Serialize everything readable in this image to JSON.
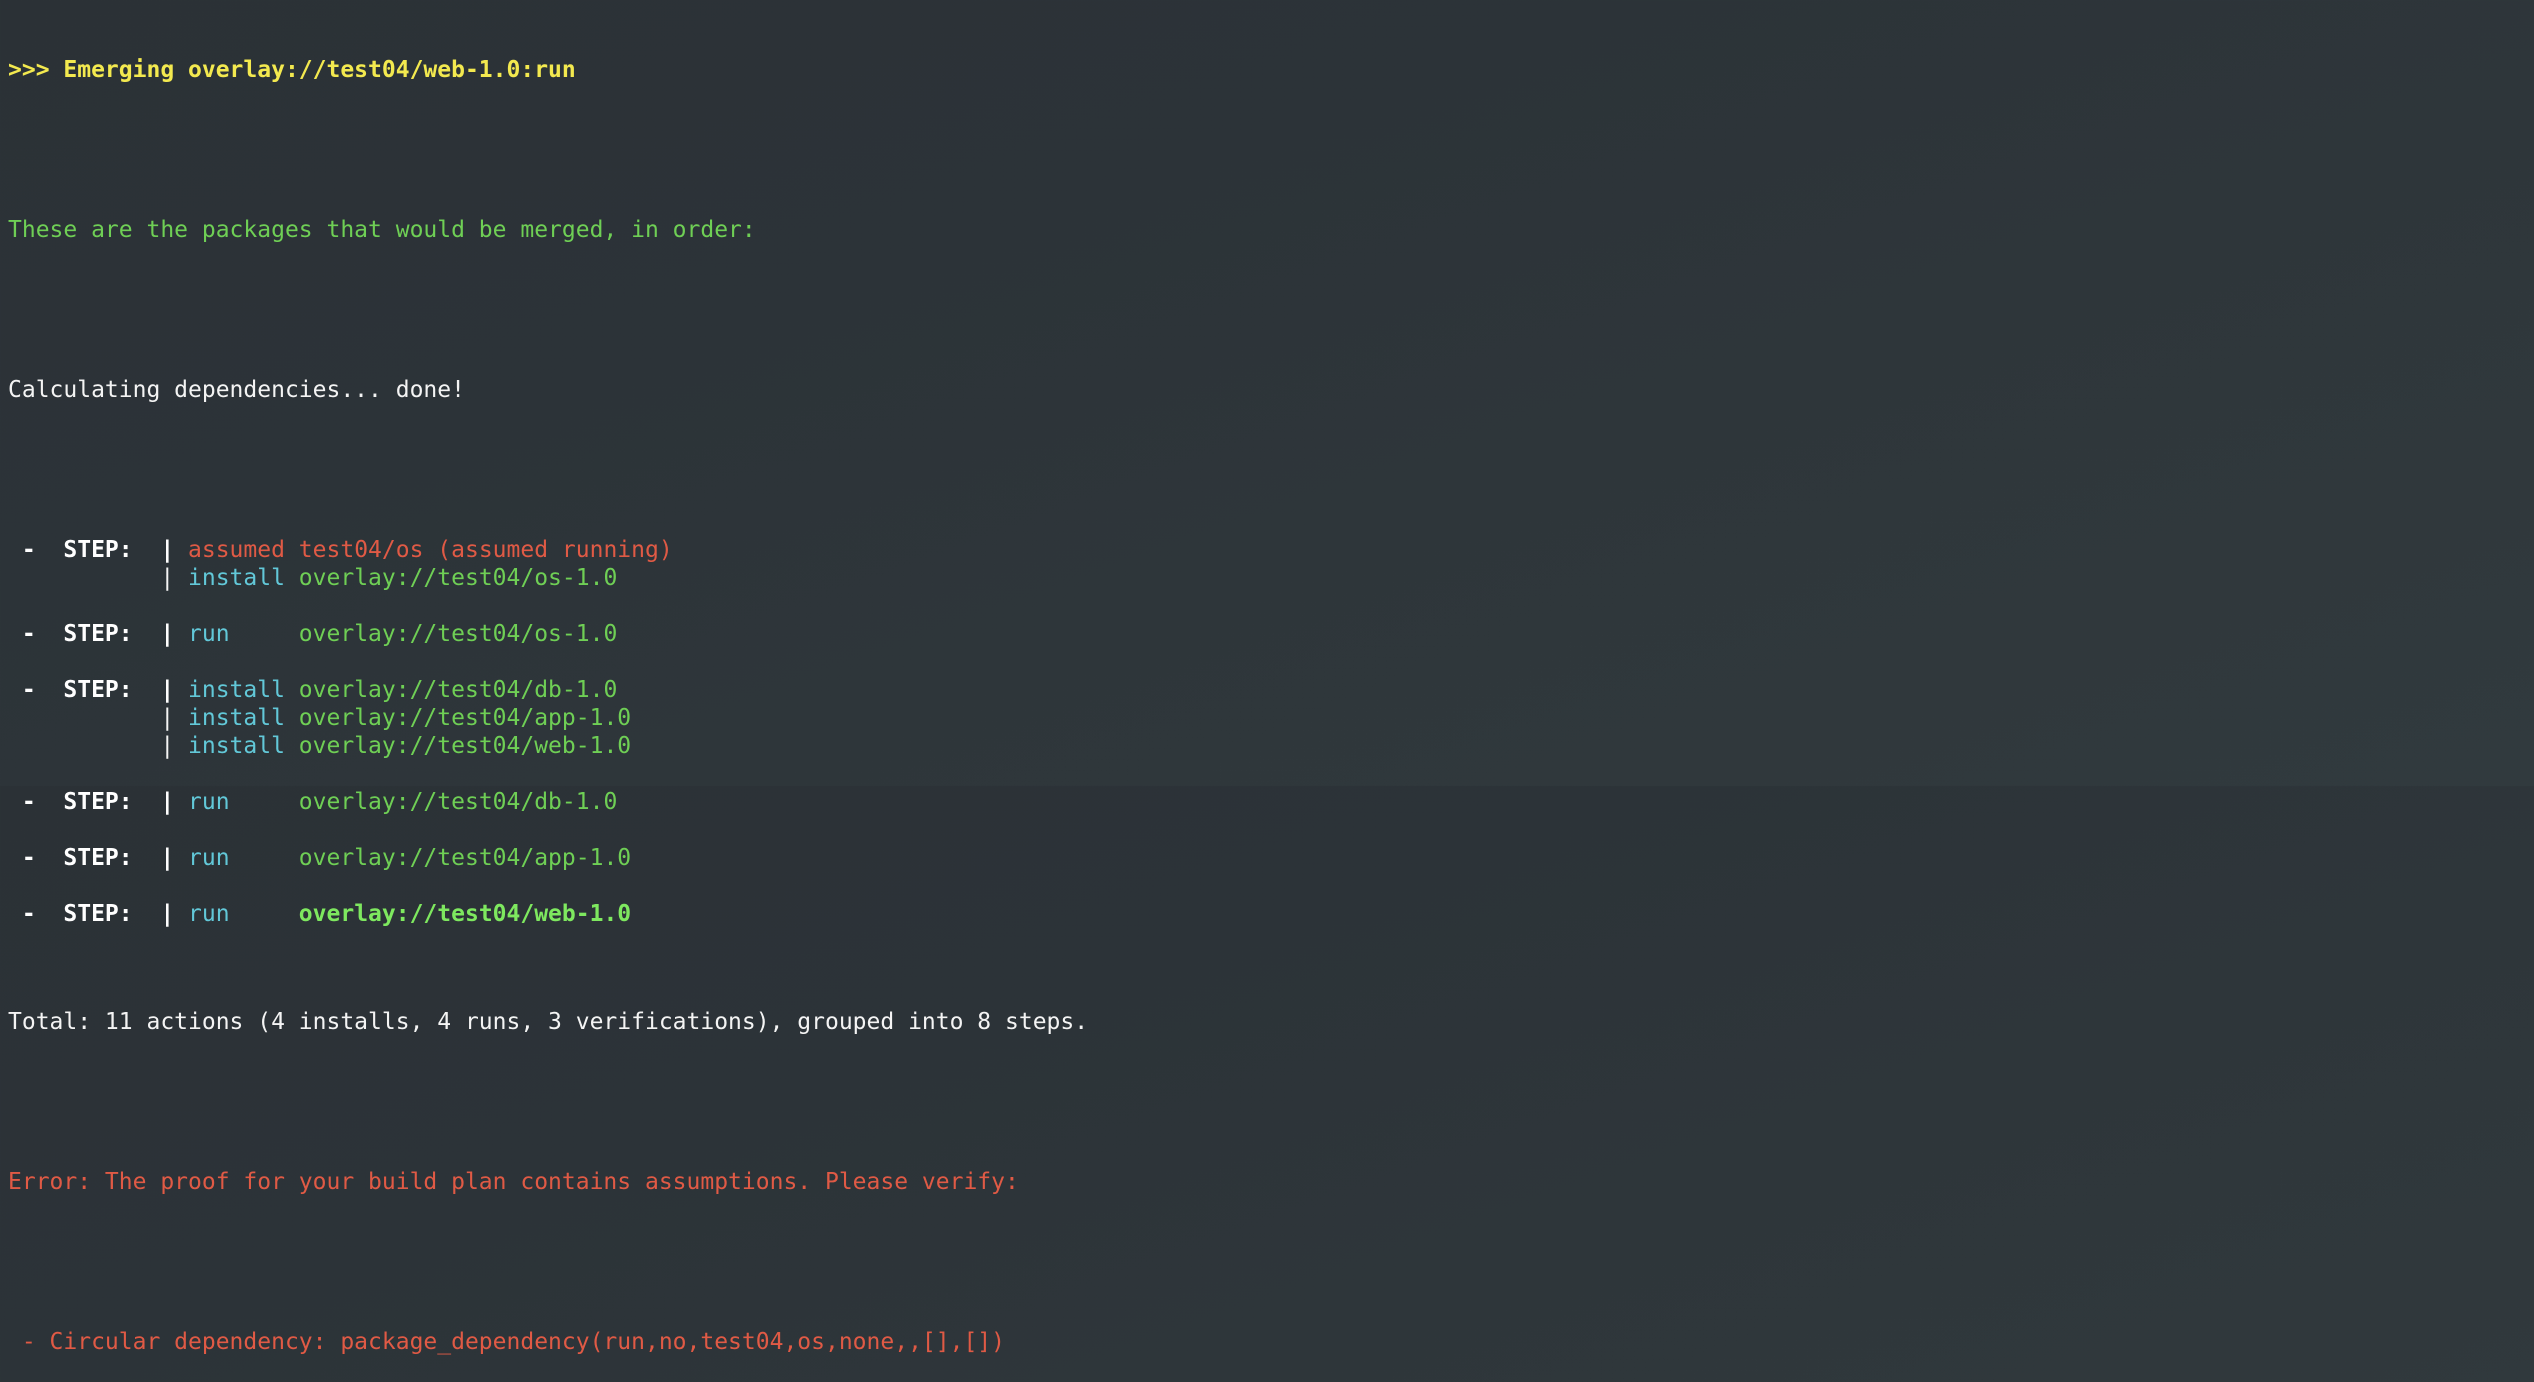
{
  "header": {
    "emerging": ">>> Emerging overlay://test04/web-1.0:run"
  },
  "intro": "These are the packages that would be merged, in order:",
  "calculating": "Calculating dependencies... done!",
  "step_prefix": " -  STEP:  |",
  "step_cont": "           |",
  "steps": [
    {
      "lines": [
        {
          "action": " assumed",
          "target": " test04/os (assumed running)",
          "kind": "assumed"
        },
        {
          "action": " install",
          "target": " overlay://test04/os-1.0",
          "kind": "install"
        }
      ]
    },
    {
      "lines": [
        {
          "action": " run    ",
          "target": " overlay://test04/os-1.0",
          "kind": "run"
        }
      ]
    },
    {
      "lines": [
        {
          "action": " install",
          "target": " overlay://test04/db-1.0",
          "kind": "install"
        },
        {
          "action": " install",
          "target": " overlay://test04/app-1.0",
          "kind": "install"
        },
        {
          "action": " install",
          "target": " overlay://test04/web-1.0",
          "kind": "install"
        }
      ]
    },
    {
      "lines": [
        {
          "action": " run    ",
          "target": " overlay://test04/db-1.0",
          "kind": "run"
        }
      ]
    },
    {
      "lines": [
        {
          "action": " run    ",
          "target": " overlay://test04/app-1.0",
          "kind": "run"
        }
      ]
    },
    {
      "lines": [
        {
          "action": " run    ",
          "target": " overlay://test04/web-1.0",
          "kind": "run-final"
        }
      ]
    }
  ],
  "total": "Total: 11 actions (4 installs, 4 runs, 3 verifications), grouped into 8 steps.",
  "error": "Error: The proof for your build plan contains assumptions. Please verify:",
  "circular": " - Circular dependency: package_dependency(run,no,test04,os,none,,[],[])",
  "colors": {
    "yellow": "#f3e94f",
    "green": "#6fcf55",
    "red": "#e05a45",
    "cyan": "#62c8d8",
    "background": "#2c3338"
  }
}
